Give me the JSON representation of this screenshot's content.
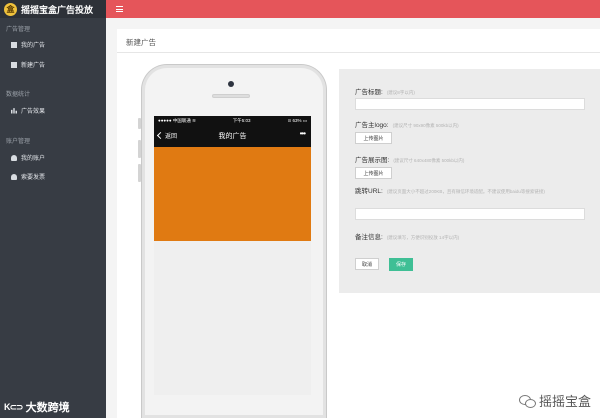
{
  "app": {
    "brand_logo_glyph": "盒",
    "brand_title": "摇摇宝盒广告投放"
  },
  "sidebar": {
    "sections": [
      {
        "title": "广告管理",
        "items": [
          {
            "label": "我的广告",
            "icon": "square-icon"
          },
          {
            "label": "新建广告",
            "icon": "square-icon"
          }
        ]
      },
      {
        "title": "数据统计",
        "items": [
          {
            "label": "广告效果",
            "icon": "chart-icon"
          }
        ]
      },
      {
        "title": "账户管理",
        "items": [
          {
            "label": "我的账户",
            "icon": "user-icon"
          },
          {
            "label": "索要发票",
            "icon": "user-icon"
          }
        ]
      }
    ]
  },
  "watermark_left": {
    "mark": "K⊂⊃",
    "text": "大数跨境"
  },
  "topbar": {
    "accent": "#e5555a"
  },
  "page": {
    "title": "新建广告"
  },
  "phone": {
    "status": {
      "carrier": "●●●●● 中国联通  ≋",
      "time": "下午5:03",
      "battery": "⊙ 63% ▭"
    },
    "nav": {
      "back": "返回",
      "title": "我的广告",
      "more": "•••"
    },
    "ad_color": "#e07a12"
  },
  "form": {
    "ad_title": {
      "label": "广告标题:",
      "hint": "(建议8字以内)"
    },
    "logo": {
      "label": "广告主logo:",
      "hint": "(建议尺寸 90x90像素 500kb以内)",
      "button": "上传图片"
    },
    "display_image": {
      "label": "广告展示图:",
      "hint": "(建议尺寸 640x480像素 500kb以内)",
      "button": "上传图片"
    },
    "jump_url": {
      "label": "跳转URL:",
      "hint": "(建议页面大小不超过200KB，且有微信环境适配。不建议使用baidu等搜索链接)"
    },
    "remark": {
      "label": "备注信息:",
      "hint": "(建议填写，方便识别投放 14字以内)"
    },
    "cancel": "取消",
    "save": "保存",
    "save_color": "#3fbf95"
  },
  "watermark_right": {
    "text": "摇摇宝盒"
  }
}
